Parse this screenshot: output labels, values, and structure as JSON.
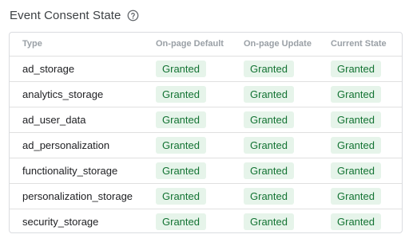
{
  "header": {
    "title": "Event Consent State"
  },
  "table": {
    "columns": [
      "Type",
      "On-page Default",
      "On-page Update",
      "Current State"
    ],
    "rows": [
      {
        "type": "ad_storage",
        "default": "Granted",
        "update": "Granted",
        "current": "Granted"
      },
      {
        "type": "analytics_storage",
        "default": "Granted",
        "update": "Granted",
        "current": "Granted"
      },
      {
        "type": "ad_user_data",
        "default": "Granted",
        "update": "Granted",
        "current": "Granted"
      },
      {
        "type": "ad_personalization",
        "default": "Granted",
        "update": "Granted",
        "current": "Granted"
      },
      {
        "type": "functionality_storage",
        "default": "Granted",
        "update": "Granted",
        "current": "Granted"
      },
      {
        "type": "personalization_storage",
        "default": "Granted",
        "update": "Granted",
        "current": "Granted"
      },
      {
        "type": "security_storage",
        "default": "Granted",
        "update": "Granted",
        "current": "Granted"
      }
    ]
  },
  "colors": {
    "granted_bg": "#e6f4ea",
    "granted_text": "#137333",
    "header_text": "#9aa0a6",
    "border": "#dadce0"
  },
  "icons": {
    "help": "help-circle-icon"
  }
}
